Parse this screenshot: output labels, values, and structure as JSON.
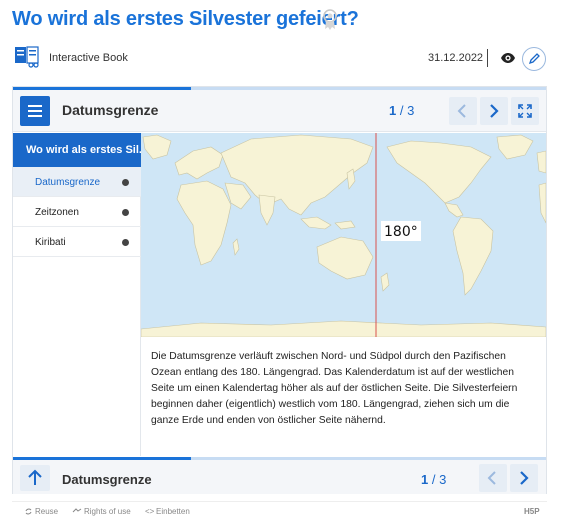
{
  "title": "Wo wird als erstes Silvester gefeiert?",
  "meta": {
    "content_type": "Interactive Book",
    "date": "31.12.2022"
  },
  "header": {
    "chapter": "Datumsgrenze",
    "page_current": "1",
    "page_sep": " / ",
    "page_total": "3"
  },
  "sidebar": {
    "heading": "Wo wird als erstes Sil...",
    "items": [
      {
        "label": "Datumsgrenze",
        "active": true
      },
      {
        "label": "Zeitzonen",
        "active": false
      },
      {
        "label": "Kiribati",
        "active": false
      }
    ]
  },
  "map": {
    "label": "180°",
    "ocean_color": "#cfe6f6",
    "land_color": "#f7f3d6",
    "line_color": "#d9534f"
  },
  "body_text": "Die Datumsgrenze verläuft zwischen Nord- und Südpol durch den Pazifischen Ozean entlang des 180. Längengrad. Das Kalenderdatum ist auf der westlichen Seite um einen Kalendertag höher als auf der östlichen Seite. Die Silvesterfeiern beginnen daher (eigentlich) westlich vom 180. Längengrad, ziehen sich um die ganze Erde und enden von östlicher Seite nähernd.",
  "footer": {
    "chapter": "Datumsgrenze",
    "page_current": "1",
    "page_sep": " / ",
    "page_total": "3"
  },
  "bottom_links": {
    "reuse": "Reuse",
    "rights": "Rights of use",
    "embed": "Einbetten",
    "brand": "H5P"
  },
  "colors": {
    "accent": "#1a68c9",
    "title": "#1a73d9"
  }
}
